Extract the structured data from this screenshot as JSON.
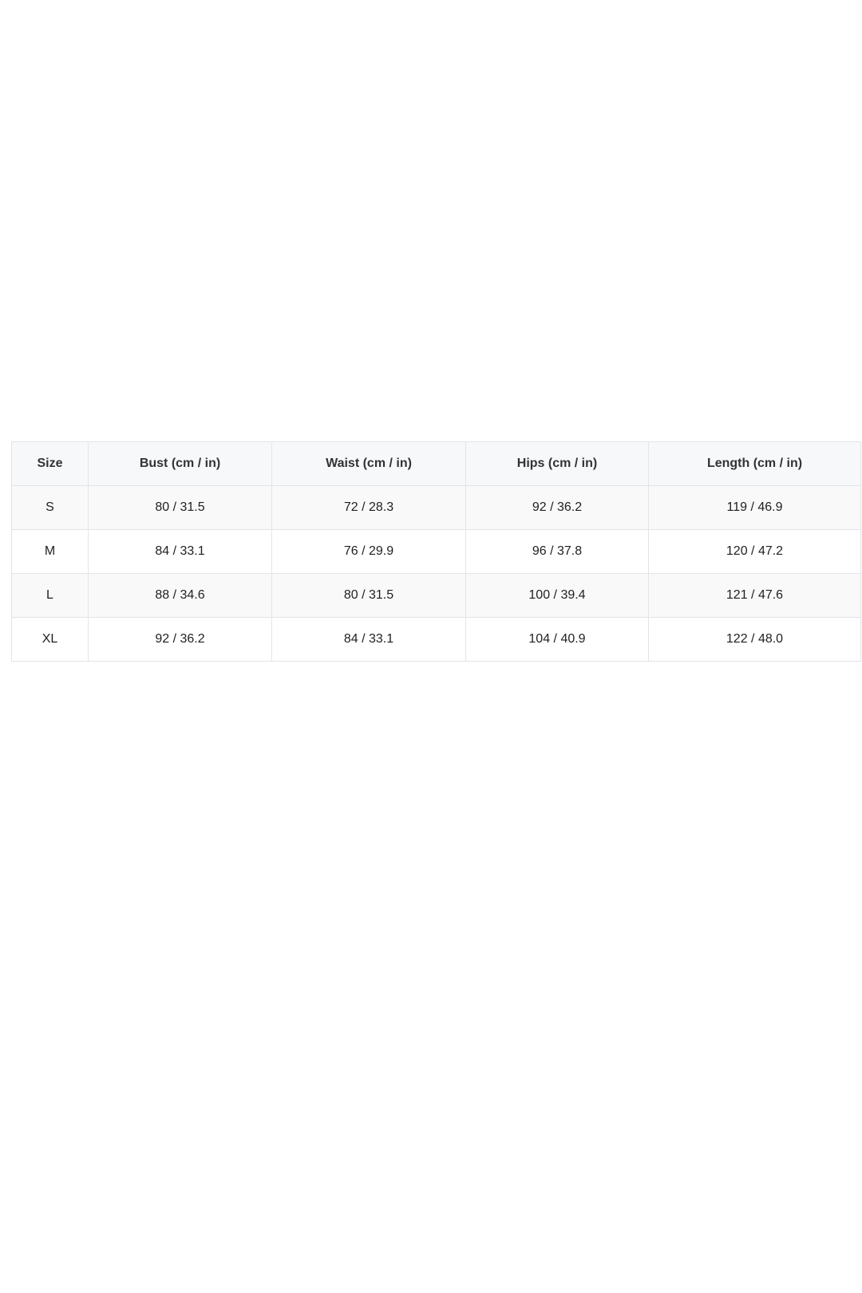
{
  "size_chart": {
    "headers": [
      "Size",
      "Bust (cm / in)",
      "Waist (cm / in)",
      "Hips (cm / in)",
      "Length (cm / in)"
    ],
    "rows": [
      [
        "S",
        "80 / 31.5",
        "72 / 28.3",
        "92 / 36.2",
        "119 / 46.9"
      ],
      [
        "M",
        "84 / 33.1",
        "76 / 29.9",
        "96 / 37.8",
        "120 / 47.2"
      ],
      [
        "L",
        "88 / 34.6",
        "80 / 31.5",
        "100 / 39.4",
        "121 / 47.6"
      ],
      [
        "XL",
        "92 / 36.2",
        "84 / 33.1",
        "104 / 40.9",
        "122 / 48.0"
      ]
    ]
  }
}
